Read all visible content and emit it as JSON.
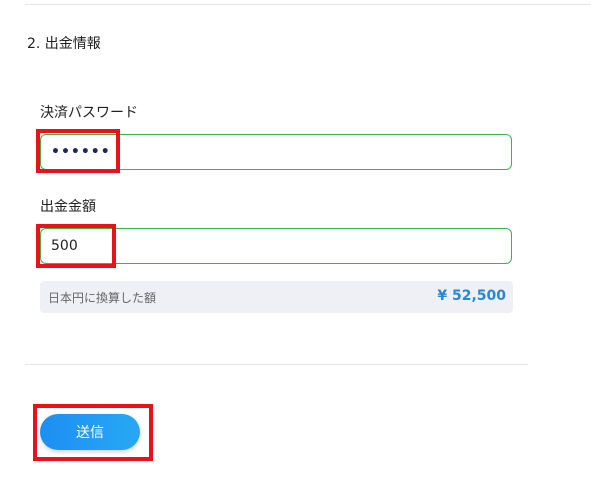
{
  "section": {
    "title": "2. 出金情報"
  },
  "password_field": {
    "label": "決済パスワード",
    "value": "••••••"
  },
  "amount_field": {
    "label": "出金金額",
    "value": "500"
  },
  "conversion": {
    "label": "日本円に換算した額",
    "value": "¥ 52,500"
  },
  "submit": {
    "label": "送信"
  },
  "colors": {
    "highlight": "#e8121a",
    "input_border": "#3cb24a",
    "accent_blue": "#2a86d6",
    "button_gradient_start": "#1c8ff2",
    "button_gradient_end": "#27a8f4"
  }
}
